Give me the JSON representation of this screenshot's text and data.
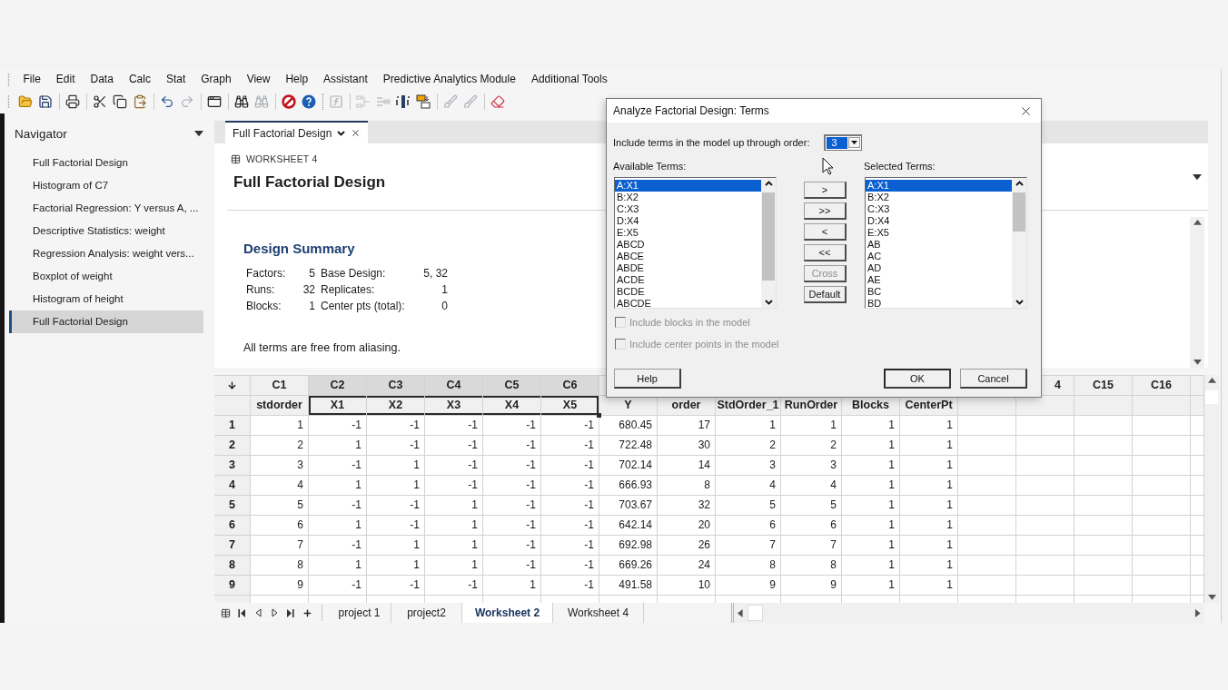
{
  "menu": [
    "File",
    "Edit",
    "Data",
    "Calc",
    "Stat",
    "Graph",
    "View",
    "Help",
    "Assistant",
    "Predictive Analytics Module",
    "Additional Tools"
  ],
  "toolbar": [
    {
      "disabled": false
    },
    {
      "disabled": false
    },
    {
      "disabled": false
    },
    {
      "disabled": false
    },
    {
      "disabled": false
    },
    {
      "disabled": false
    },
    {
      "disabled": false
    },
    {
      "disabled": true
    },
    {
      "disabled": false
    },
    {
      "disabled": false
    },
    {
      "disabled": true
    },
    {
      "disabled": false
    },
    {
      "disabled": false
    },
    {
      "disabled": true
    },
    {
      "disabled": true
    },
    {
      "disabled": true
    },
    {
      "disabled": false
    },
    {
      "disabled": false
    },
    {
      "disabled": true
    },
    {
      "disabled": true
    },
    {
      "disabled": false
    }
  ],
  "navigator": {
    "title": "Navigator",
    "items": [
      {
        "label": "Full Factorial Design",
        "selected": false
      },
      {
        "label": "Histogram of C7",
        "selected": false
      },
      {
        "label": "Factorial Regression: Y versus A, ...",
        "selected": false
      },
      {
        "label": "Descriptive Statistics: weight",
        "selected": false
      },
      {
        "label": "Regression Analysis: weight vers...",
        "selected": false
      },
      {
        "label": "Boxplot of weight",
        "selected": false
      },
      {
        "label": "Histogram of height",
        "selected": false
      },
      {
        "label": "Full Factorial Design",
        "selected": true
      }
    ]
  },
  "tabs": [
    {
      "label": "Full Factorial Design",
      "selected": true
    }
  ],
  "output": {
    "worksheet_label": "WORKSHEET 4",
    "title": "Full Factorial Design",
    "section_title": "Design Summary",
    "summary": [
      [
        "Factors:",
        "5",
        "Base Design:",
        "5, 32"
      ],
      [
        "Runs:",
        "32",
        "Replicates:",
        "1"
      ],
      [
        "Blocks:",
        "1",
        "Center pts (total):",
        "0"
      ]
    ],
    "note": "All terms are free from aliasing."
  },
  "worksheet": {
    "columns": [
      {
        "id": "C1",
        "name": "stdorder",
        "selected": false
      },
      {
        "id": "C2",
        "name": "X1",
        "selected": true
      },
      {
        "id": "C3",
        "name": "X2",
        "selected": true
      },
      {
        "id": "C4",
        "name": "X3",
        "selected": true
      },
      {
        "id": "C5",
        "name": "X4",
        "selected": true
      },
      {
        "id": "C6",
        "name": "X5",
        "selected": true
      },
      {
        "name": "Y",
        "selected": false
      },
      {
        "name": "order",
        "selected": false
      },
      {
        "name": "StdOrder_1",
        "selected": false
      },
      {
        "name": "RunOrder",
        "selected": false
      },
      {
        "name": "Blocks",
        "selected": false
      },
      {
        "name": "CenterPt",
        "selected": false
      },
      {
        "selected": false
      },
      {
        "id": "4",
        "selected": false
      },
      {
        "id": "C15",
        "selected": false
      },
      {
        "id": "C16",
        "selected": false
      }
    ],
    "rows": [
      {
        "number": "1",
        "cells": [
          "1",
          "-1",
          "-1",
          "-1",
          "-1",
          "-1",
          "680.45",
          "17",
          "1",
          "1",
          "1",
          "1"
        ]
      },
      {
        "number": "2",
        "cells": [
          "2",
          "1",
          "-1",
          "-1",
          "-1",
          "-1",
          "722.48",
          "30",
          "2",
          "2",
          "1",
          "1"
        ]
      },
      {
        "number": "3",
        "cells": [
          "3",
          "-1",
          "1",
          "-1",
          "-1",
          "-1",
          "702.14",
          "14",
          "3",
          "3",
          "1",
          "1"
        ]
      },
      {
        "number": "4",
        "cells": [
          "4",
          "1",
          "1",
          "-1",
          "-1",
          "-1",
          "666.93",
          "8",
          "4",
          "4",
          "1",
          "1"
        ]
      },
      {
        "number": "5",
        "cells": [
          "5",
          "-1",
          "-1",
          "1",
          "-1",
          "-1",
          "703.67",
          "32",
          "5",
          "5",
          "1",
          "1"
        ]
      },
      {
        "number": "6",
        "cells": [
          "6",
          "1",
          "-1",
          "1",
          "-1",
          "-1",
          "642.14",
          "20",
          "6",
          "6",
          "1",
          "1"
        ]
      },
      {
        "number": "7",
        "cells": [
          "7",
          "-1",
          "1",
          "1",
          "-1",
          "-1",
          "692.98",
          "26",
          "7",
          "7",
          "1",
          "1"
        ]
      },
      {
        "number": "8",
        "cells": [
          "8",
          "1",
          "1",
          "1",
          "-1",
          "-1",
          "669.26",
          "24",
          "8",
          "8",
          "1",
          "1"
        ]
      },
      {
        "number": "9",
        "cells": [
          "9",
          "-1",
          "-1",
          "-1",
          "1",
          "-1",
          "491.58",
          "10",
          "9",
          "9",
          "1",
          "1"
        ]
      }
    ]
  },
  "sheet_tabs": [
    {
      "label": "project 1",
      "selected": false
    },
    {
      "label": "project2",
      "selected": false
    },
    {
      "label": "Worksheet 2",
      "selected": true
    },
    {
      "label": "Worksheet 4",
      "selected": false
    }
  ],
  "dialog": {
    "title": "Analyze Factorial Design: Terms",
    "order": {
      "label": "Include terms in the model up through order:",
      "value": "3",
      "highlighted": true
    },
    "available_label": "Available Terms:",
    "available_terms": [
      {
        "label": "A:X1",
        "selected": true
      },
      {
        "label": "B:X2",
        "selected": false
      },
      {
        "label": "C:X3",
        "selected": false
      },
      {
        "label": "D:X4",
        "selected": false
      },
      {
        "label": "E:X5",
        "selected": false
      },
      {
        "label": "ABCD",
        "selected": false
      },
      {
        "label": "ABCE",
        "selected": false
      },
      {
        "label": "ABDE",
        "selected": false
      },
      {
        "label": "ACDE",
        "selected": false
      },
      {
        "label": "BCDE",
        "selected": false
      },
      {
        "label": "ABCDE",
        "selected": false
      }
    ],
    "move_buttons": [
      {
        "label": ">",
        "disabled": false
      },
      {
        "label": ">>",
        "disabled": false
      },
      {
        "label": "<",
        "disabled": false
      },
      {
        "label": "<<",
        "disabled": false
      },
      {
        "label": "Cross",
        "disabled": true
      },
      {
        "label": "Default",
        "disabled": false
      }
    ],
    "selected_label": "Selected Terms:",
    "selected_terms": [
      {
        "label": "A:X1",
        "selected": true
      },
      {
        "label": "B:X2",
        "selected": false
      },
      {
        "label": "C:X3",
        "selected": false
      },
      {
        "label": "D:X4",
        "selected": false
      },
      {
        "label": "E:X5",
        "selected": false
      },
      {
        "label": "AB",
        "selected": false
      },
      {
        "label": "AC",
        "selected": false
      },
      {
        "label": "AD",
        "selected": false
      },
      {
        "label": "AE",
        "selected": false
      },
      {
        "label": "BC",
        "selected": false
      },
      {
        "label": "BD",
        "selected": false
      }
    ],
    "options": [
      {
        "label": "Include blocks in the model",
        "checked": false,
        "disabled": true
      },
      {
        "label": "Include center points in the model",
        "checked": false,
        "disabled": true
      }
    ],
    "help_button": "Help",
    "buttons": [
      {
        "label": "OK",
        "default": true
      },
      {
        "label": "Cancel",
        "default": false
      }
    ]
  }
}
